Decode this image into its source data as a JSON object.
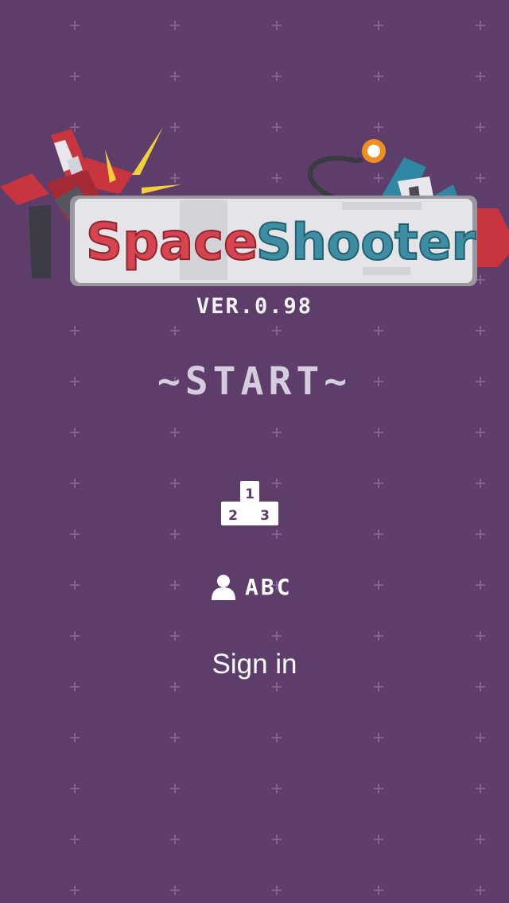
{
  "game": {
    "title_word_1": "Space",
    "title_word_2": "Shooter",
    "version": "VER.0.98",
    "start_label": "~START~",
    "leaderboard": {
      "icon": "leaderboard-podium-icon",
      "places": [
        "1",
        "2",
        "3"
      ]
    },
    "player": {
      "icon": "person-icon",
      "name": "ABC"
    },
    "sign_in_label": "Sign in"
  },
  "colors": {
    "background": "#5d3d6a",
    "title_red": "#d64450",
    "title_teal": "#3d8ea3",
    "start_text": "#d4cddd",
    "white": "#ffffff"
  }
}
